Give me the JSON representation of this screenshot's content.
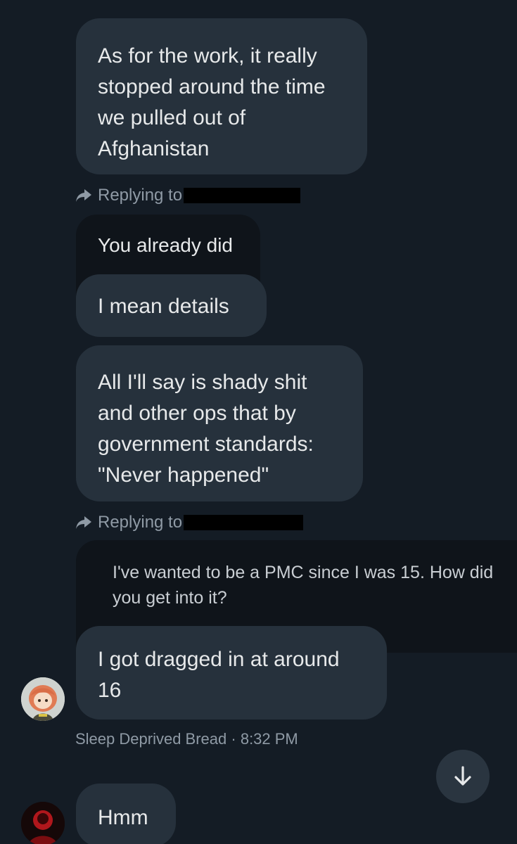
{
  "messages": [
    {
      "text": "As for the work, it really stopped around the time we pulled out of Afghanistan"
    },
    {
      "text": "You already did"
    },
    {
      "text": "I mean details"
    },
    {
      "text": "All I'll say is shady shit and other ops that by government standards: \"Never happened\""
    },
    {
      "text": "I got dragged in at around 16"
    },
    {
      "text": "Hmm"
    }
  ],
  "replies": [
    {
      "label": "Replying to"
    },
    {
      "label": "Replying to"
    }
  ],
  "quoted": {
    "text": "I've wanted to be a PMC since I was 15. How did you get into it?"
  },
  "meta": {
    "sender": "Sleep Deprived Bread",
    "separator": "·",
    "time": "8:32 PM"
  },
  "icons": {
    "reply": "reply-arrow-icon",
    "scroll": "arrow-down-icon"
  },
  "colors": {
    "background": "#141c25",
    "bubble": "#26313c",
    "quoted": "#0f141a",
    "meta_text": "#8f9aa5"
  }
}
